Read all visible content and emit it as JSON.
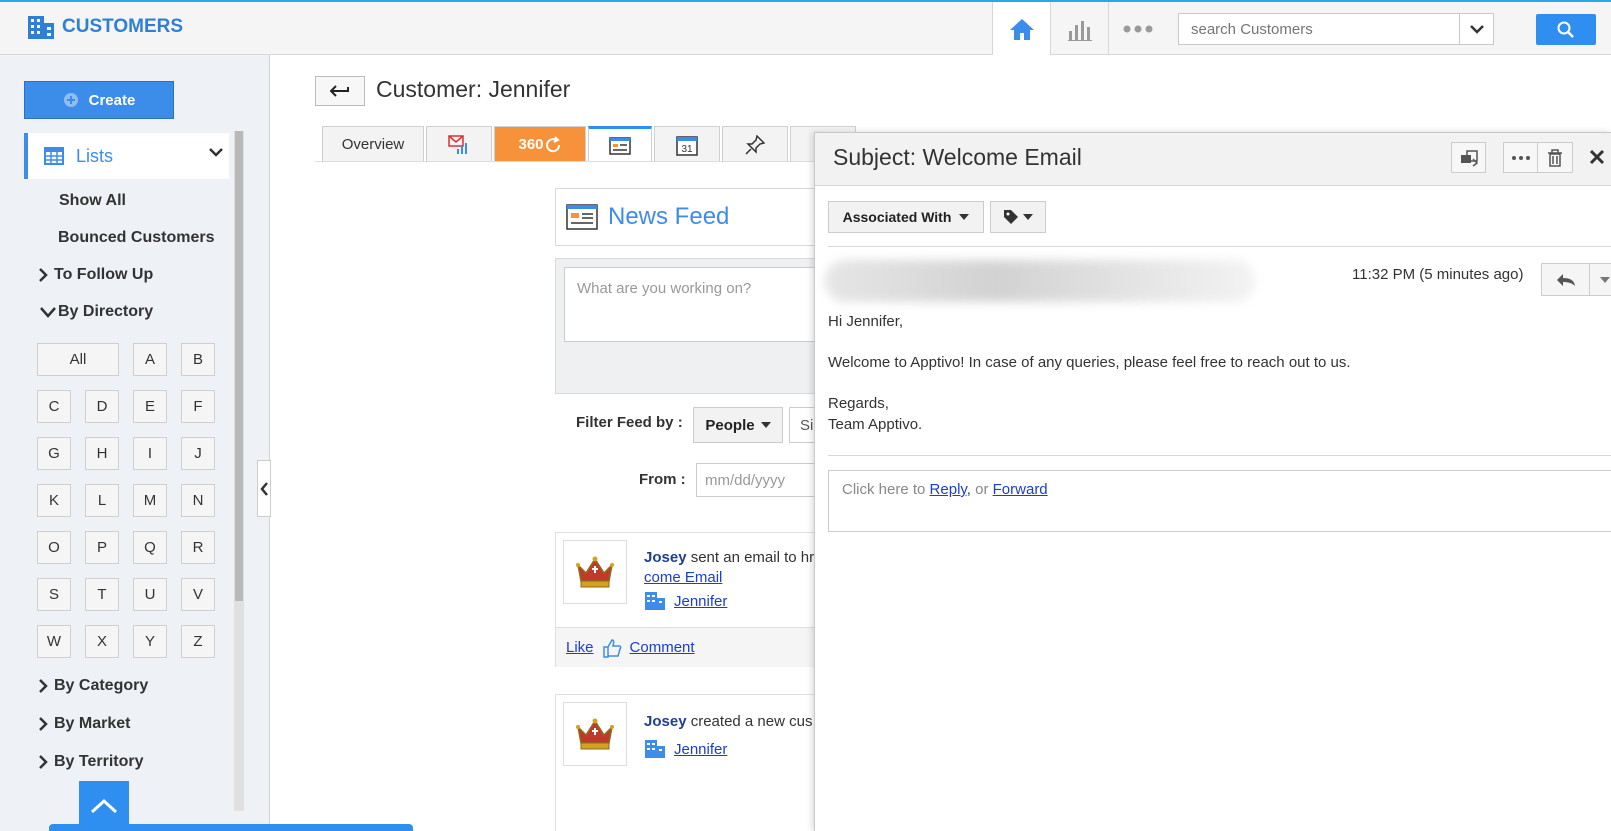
{
  "topbar": {
    "brand": "CUSTOMERS",
    "search_placeholder": "search Customers"
  },
  "sidebar": {
    "create_label": "Create",
    "lists_label": "Lists",
    "show_all": "Show All",
    "bounced": "Bounced Customers",
    "to_follow_up": "To Follow Up",
    "by_directory": "By Directory",
    "letters": [
      "All",
      "A",
      "B",
      "C",
      "D",
      "E",
      "F",
      "G",
      "H",
      "I",
      "J",
      "K",
      "L",
      "M",
      "N",
      "O",
      "P",
      "Q",
      "R",
      "S",
      "T",
      "U",
      "V",
      "W",
      "X",
      "Y",
      "Z"
    ],
    "by_category": "By Category",
    "by_market": "By Market",
    "by_territory": "By Territory"
  },
  "page": {
    "title": "Customer: Jennifer",
    "tabs": {
      "overview": "Overview",
      "t360": "360"
    }
  },
  "feed": {
    "title": "News Feed",
    "composer_placeholder": "What are you working on?",
    "filter_label": "Filter Feed by :",
    "people": "People",
    "si": "Si",
    "from_label": "From :",
    "date_placeholder": "mm/dd/yyyy",
    "items": [
      {
        "user": "Josey",
        "action": "sent an email to hr",
        "link": "come Email",
        "customer": "Jennifer"
      },
      {
        "user": "Josey",
        "action": "created a new cus",
        "customer": "Jennifer"
      }
    ],
    "like": "Like",
    "comment": "Comment"
  },
  "email": {
    "subject": "Subject: Welcome Email",
    "associated": "Associated With",
    "timestamp": "11:32 PM (5 minutes ago)",
    "greeting": "Hi Jennifer,",
    "body": "Welcome to Apptivo! In case of any queries, please feel free to reach out to us.",
    "regards": "Regards,",
    "team": "Team Apptivo.",
    "reply_prompt": "Click here to",
    "reply": "Reply,",
    "or": "or",
    "forward": "Forward"
  },
  "colors": {
    "accent": "#2f8ff0",
    "orange": "#f7923a",
    "link": "#1a3ecf"
  }
}
